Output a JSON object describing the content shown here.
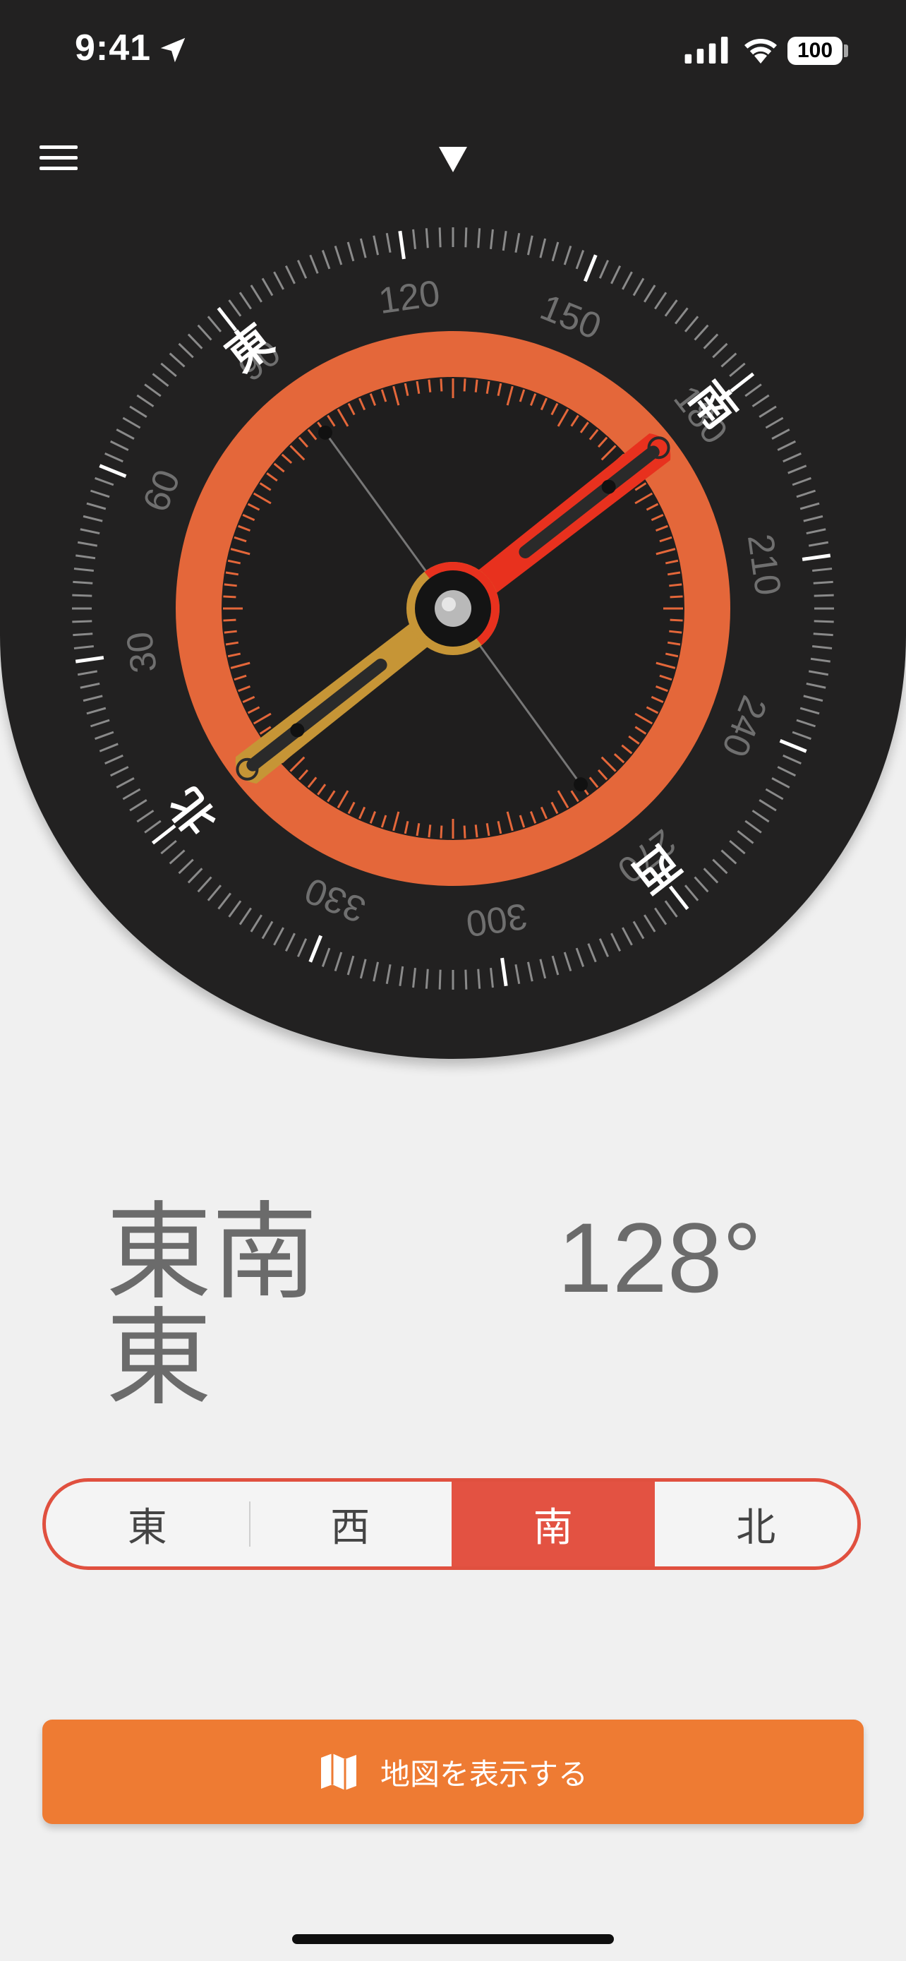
{
  "status_bar": {
    "time": "9:41",
    "battery": "100"
  },
  "compass": {
    "heading_deg": 128,
    "cardinal_labels": [
      {
        "label": "北",
        "bearing": 0
      },
      {
        "label": "東",
        "bearing": 90
      },
      {
        "label": "南",
        "bearing": 180
      },
      {
        "label": "西",
        "bearing": 270
      }
    ],
    "degree_labels": [
      "30",
      "60",
      "90",
      "120",
      "150",
      "180",
      "210",
      "240",
      "270",
      "300",
      "330"
    ],
    "colors": {
      "ring": "#e4673a",
      "needle_south": "#e8311e",
      "needle_north": "#c69536",
      "dial": "#222121"
    }
  },
  "readout": {
    "direction": "東南東",
    "degrees": "128°"
  },
  "segments": [
    {
      "label": "東",
      "selected": false
    },
    {
      "label": "西",
      "selected": false
    },
    {
      "label": "南",
      "selected": true
    },
    {
      "label": "北",
      "selected": false
    }
  ],
  "map_button": {
    "label": "地図を表示する",
    "icon": "map-icon",
    "color": "#ee7b33"
  },
  "icons": [
    "location-arrow-icon",
    "signal-icon",
    "wifi-icon",
    "battery-icon",
    "menu-icon",
    "heading-pointer-icon",
    "map-icon"
  ]
}
